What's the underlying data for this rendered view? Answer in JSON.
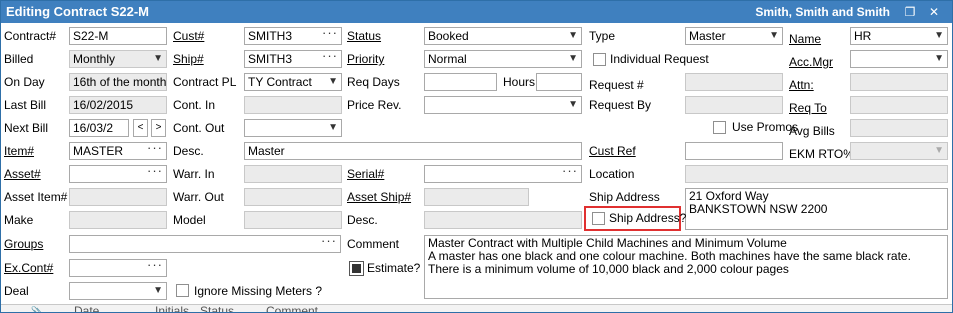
{
  "window": {
    "title": "Editing Contract S22-M",
    "company": "Smith, Smith and Smith",
    "restore_icon": "restore-icon",
    "close_icon": "close-icon"
  },
  "col1": {
    "contract_label": "Contract#",
    "contract_value": "S22-M",
    "billed_label": "Billed",
    "billed_value": "Monthly",
    "onday_label": "On Day",
    "onday_value": "16th of the month",
    "lastbill_label": "Last Bill",
    "lastbill_value": "16/02/2015",
    "nextbill_label": "Next Bill",
    "nextbill_value": "16/03/2",
    "item_label": "Item#",
    "item_value": "MASTER",
    "asset_label": "Asset#",
    "asset_value": "",
    "assetitem_label": "Asset Item#",
    "assetitem_value": "",
    "make_label": "Make",
    "make_value": "",
    "groups_label": "Groups",
    "groups_value": "",
    "excont_label": "Ex.Cont#",
    "excont_value": "",
    "deal_label": "Deal",
    "deal_value": ""
  },
  "col2": {
    "cust_label": "Cust#",
    "cust_value": "SMITH3",
    "ship_label": "Ship#",
    "ship_value": "SMITH3",
    "contractpl_label": "Contract PL",
    "contractpl_value": "TY Contract",
    "contin_label": "Cont. In",
    "contin_value": "",
    "contout_label": "Cont. Out",
    "contout_value": "",
    "desc_label": "Desc.",
    "desc_value": "Master",
    "warrin_label": "Warr. In",
    "warrin_value": "",
    "warrout_label": "Warr. Out",
    "warrout_value": "",
    "model_label": "Model",
    "model_value": ""
  },
  "col3": {
    "status_label": "Status",
    "status_value": "Booked",
    "priority_label": "Priority",
    "priority_value": "Normal",
    "reqdays_label": "Req Days",
    "reqdays_value": "",
    "hours_label": "Hours",
    "hours_value": "",
    "pricerev_label": "Price Rev.",
    "pricerev_value": "",
    "serial_label": "Serial#",
    "serial_value": "",
    "assetship_label": "Asset Ship#",
    "assetship_value": "",
    "desc2_label": "Desc.",
    "desc2_value": "",
    "comment_label": "Comment",
    "comment_value": "Master Contract with Multiple Child Machines and Minimum Volume\nA master has one black and one colour machine. Both machines have the same black rate. There is a minimum volume of 10,000 black and 2,000 colour pages",
    "estimate_label": "Estimate?"
  },
  "col4": {
    "type_label": "Type",
    "type_value": "Master",
    "individual_request_label": "Individual Request",
    "request_label": "Request #",
    "request_value": "",
    "requestby_label": "Request By",
    "requestby_value": "",
    "usepromos_label": "Use Promos",
    "custref_label": "Cust Ref",
    "custref_value": "",
    "location_label": "Location",
    "location_value": "",
    "shipaddr_label": "Ship Address",
    "shipaddr_value": "21 Oxford Way\nBANKSTOWN NSW 2200",
    "shipaddr_check_label": "Ship Address?",
    "ignore_meters_label": "Ignore Missing Meters ?"
  },
  "col5": {
    "name_label": "Name",
    "name_value": "HR",
    "accmgr_label": "Acc.Mgr",
    "accmgr_value": "",
    "attn_label": "Attn:",
    "attn_value": "",
    "reqto_label": "Req To",
    "reqto_value": "",
    "avgbills_label": "Avg Bills",
    "avgbills_value": "",
    "ekm_label": "EKM RTO%",
    "ekm_value": ""
  },
  "grid": {
    "col_date": "Date",
    "col_initials": "Initials",
    "col_status": "Status",
    "col_comment": "Comment"
  }
}
